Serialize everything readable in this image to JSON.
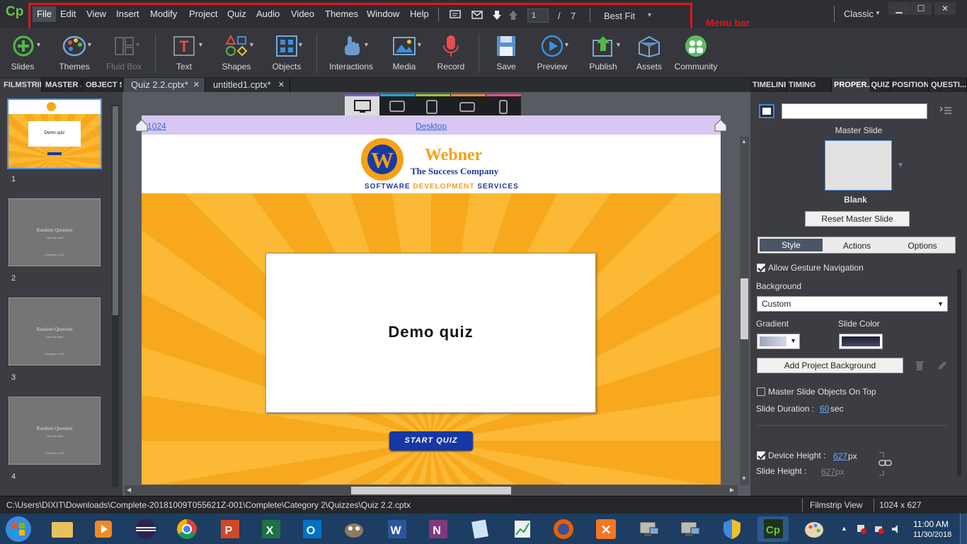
{
  "app": {
    "logo": "Cp",
    "workspace": "Classic"
  },
  "menu": {
    "items": [
      "File",
      "Edit",
      "View",
      "Insert",
      "Modify",
      "Project",
      "Quiz",
      "Audio",
      "Video",
      "Themes",
      "Window",
      "Help"
    ],
    "page_current": "1",
    "page_sep": "/",
    "page_total": "7",
    "zoom": "Best Fit",
    "annotation": "Menu bar"
  },
  "toolbar": {
    "slides": "Slides",
    "themes": "Themes",
    "fluid_box": "Fluid Box",
    "text": "Text",
    "shapes": "Shapes",
    "objects": "Objects",
    "interactions": "Interactions",
    "media": "Media",
    "record": "Record",
    "save": "Save",
    "preview": "Preview",
    "publish": "Publish",
    "assets": "Assets",
    "community": "Community"
  },
  "left_tabs": [
    "FILMSTRIP",
    "MASTER ...",
    "OBJECT S..."
  ],
  "doc_tabs": [
    "Quiz 2.2.cptx*",
    "untitled1.cptx*"
  ],
  "right_tabs": [
    "TIMELINE",
    "TIMING",
    "PROPER...",
    "QUIZ",
    "POSITION",
    "QUESTI..."
  ],
  "filmstrip": {
    "slides": [
      {
        "num": "1"
      },
      {
        "num": "2",
        "title": "Random Question",
        "sub": "Type the slide",
        "foot": "Question 1 of 3"
      },
      {
        "num": "3",
        "title": "Random Question",
        "sub": "Type the slide",
        "foot": "Question 1 of 3"
      },
      {
        "num": "4",
        "title": "Random Question",
        "sub": "Type the slide",
        "foot": "Question 1 of 3"
      }
    ],
    "slide1_title": "Demo quiz"
  },
  "stage": {
    "ruler_width": "1024",
    "ruler_label": "Desktop",
    "brand_name": "Webner",
    "brand_tagline": "The Success Company",
    "brand_services_1": "SOFTWARE ",
    "brand_services_2": "DEVELOPMENT",
    "brand_services_3": " SERVICES",
    "logo_letter": "W",
    "quiz_title": "Demo quiz",
    "start_button": "START QUIZ",
    "device_colors": [
      "#1aa3d9",
      "#9ac43a",
      "#e8892e",
      "#e84c8b"
    ]
  },
  "properties": {
    "master_slide_label": "Master Slide",
    "master_name": "Blank",
    "reset_master": "Reset Master Slide",
    "tabs": [
      "Style",
      "Actions",
      "Options"
    ],
    "allow_gesture": "Allow Gesture Navigation",
    "background_label": "Background",
    "background_value": "Custom",
    "gradient_label": "Gradient",
    "slide_color_label": "Slide Color",
    "add_bg": "Add Project Background",
    "master_on_top": "Master Slide Objects On Top",
    "duration_label": "Slide Duration :",
    "duration_value": "60",
    "duration_unit": "sec",
    "device_height_label": "Device Height :",
    "device_height_value": "627",
    "device_height_unit": "px",
    "slide_height_label": "Slide Height :",
    "slide_height_value": "627",
    "slide_height_unit": "px"
  },
  "status": {
    "path": "C:\\Users\\DIXIT\\Downloads\\Complete-20181009T055621Z-001\\Complete\\Category 2\\Quizzes\\Quiz 2.2.cptx",
    "view": "Filmstrip View",
    "dims": "1024 x 627"
  },
  "taskbar": {
    "time": "11:00 AM",
    "date": "11/30/2018"
  },
  "colors": {
    "accent_red": "#e0161c",
    "brand_orange": "#f7a81c",
    "start_blue": "#1637a6"
  }
}
